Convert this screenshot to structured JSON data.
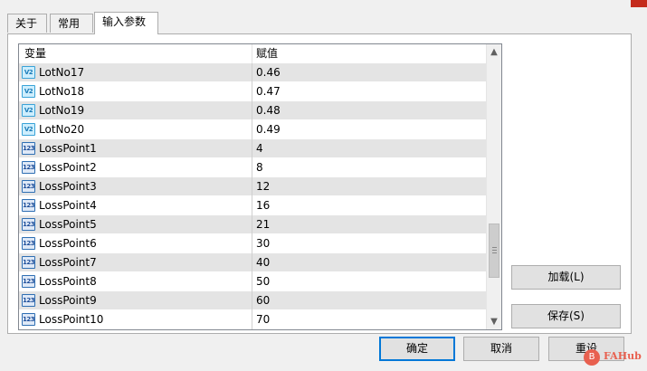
{
  "tabs": [
    {
      "label": "关于",
      "active": false
    },
    {
      "label": "常用",
      "active": false
    },
    {
      "label": "输入参数",
      "active": true
    }
  ],
  "table": {
    "columns": [
      "变量",
      "赋值"
    ],
    "rows": [
      {
        "icon": "fraction-type-icon",
        "icon_text": "V2",
        "name": "LotNo17",
        "value": "0.46"
      },
      {
        "icon": "fraction-type-icon",
        "icon_text": "V2",
        "name": "LotNo18",
        "value": "0.47"
      },
      {
        "icon": "fraction-type-icon",
        "icon_text": "V2",
        "name": "LotNo19",
        "value": "0.48"
      },
      {
        "icon": "fraction-type-icon",
        "icon_text": "V2",
        "name": "LotNo20",
        "value": "0.49"
      },
      {
        "icon": "integer-type-icon",
        "icon_text": "123",
        "name": "LossPoint1",
        "value": "4"
      },
      {
        "icon": "integer-type-icon",
        "icon_text": "123",
        "name": "LossPoint2",
        "value": "8"
      },
      {
        "icon": "integer-type-icon",
        "icon_text": "123",
        "name": "LossPoint3",
        "value": "12"
      },
      {
        "icon": "integer-type-icon",
        "icon_text": "123",
        "name": "LossPoint4",
        "value": "16"
      },
      {
        "icon": "integer-type-icon",
        "icon_text": "123",
        "name": "LossPoint5",
        "value": "21"
      },
      {
        "icon": "integer-type-icon",
        "icon_text": "123",
        "name": "LossPoint6",
        "value": "30"
      },
      {
        "icon": "integer-type-icon",
        "icon_text": "123",
        "name": "LossPoint7",
        "value": "40"
      },
      {
        "icon": "integer-type-icon",
        "icon_text": "123",
        "name": "LossPoint8",
        "value": "50"
      },
      {
        "icon": "integer-type-icon",
        "icon_text": "123",
        "name": "LossPoint9",
        "value": "60"
      },
      {
        "icon": "integer-type-icon",
        "icon_text": "123",
        "name": "LossPoint10",
        "value": "70"
      }
    ]
  },
  "buttons": {
    "load": "加载(L)",
    "save": "保存(S)",
    "ok": "确定",
    "cancel": "取消",
    "reset": "重设"
  },
  "scrollbar": {
    "up_glyph": "▲",
    "down_glyph": "▼"
  },
  "watermark": {
    "badge": "B",
    "text": "FAHub"
  },
  "colors": {
    "accent": "#0078d7",
    "row_alt": "#e4e4e4",
    "close": "#c42b1c"
  }
}
